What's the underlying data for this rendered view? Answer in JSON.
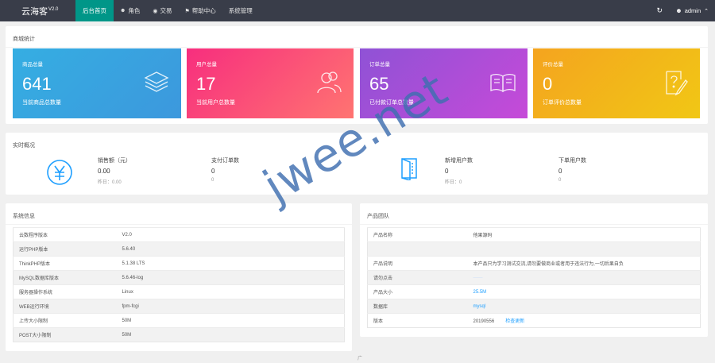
{
  "app": {
    "logo_text": "云海客",
    "logo_version": "V2.0"
  },
  "nav": [
    {
      "label": "后台首页",
      "icon": ""
    },
    {
      "label": "角色",
      "icon": "user-icon"
    },
    {
      "label": "交易",
      "icon": "coins-icon"
    },
    {
      "label": "帮助中心",
      "icon": "flag-icon"
    },
    {
      "label": "系统管理",
      "icon": ""
    }
  ],
  "topright": {
    "refresh_icon": "refresh-icon",
    "user_name": "admin",
    "user_icon": "user-icon",
    "caret_icon": "chevron-up-icon"
  },
  "stats": {
    "title": "商城统计",
    "tiles": [
      {
        "label": "商品总量",
        "value": "641",
        "sub": "当前商品总数量",
        "icon": "layers-icon",
        "color_from": "#34a9e1",
        "color_to": "#3b9bde"
      },
      {
        "label": "用户总量",
        "value": "17",
        "sub": "当前用户总数量",
        "icon": "users-icon",
        "color_from": "#f8317d",
        "color_to": "#ff6f72"
      },
      {
        "label": "订单总量",
        "value": "65",
        "sub": "已付款订单总数量",
        "icon": "book-icon",
        "color_from": "#8e51d6",
        "color_to": "#c24ad8"
      },
      {
        "label": "评价总量",
        "value": "0",
        "sub": "订单评价总数量",
        "icon": "edit-icon",
        "color_from": "#f3a51f",
        "color_to": "#f1c516"
      }
    ]
  },
  "realtime": {
    "title": "实时概况",
    "items": [
      {
        "label": "销售额（元）",
        "value": "0.00",
        "sub": "昨日：0.00"
      },
      {
        "label": "支付订单数",
        "value": "0",
        "sub": "0"
      },
      {
        "label": "新增用户数",
        "value": "0",
        "sub": "昨日：0"
      },
      {
        "label": "下单用户数",
        "value": "0",
        "sub": "0"
      }
    ]
  },
  "system": {
    "title": "系统信息",
    "rows": [
      [
        "云数程序版本",
        "V2.0"
      ],
      [
        "运行PHP版本",
        "5.6.40"
      ],
      [
        "ThinkPHP版本",
        "5.1.38 LTS"
      ],
      [
        "MySQL数据库版本",
        "5.6.46-log"
      ],
      [
        "服务器操作系统",
        "Linux"
      ],
      [
        "WEB运行环境",
        "fpm-fcgi"
      ],
      [
        "上传大小限制",
        "50M"
      ],
      [
        "POST大小限制",
        "50M"
      ]
    ]
  },
  "product": {
    "title": "产品团队",
    "rows": [
      {
        "k": "产品名称",
        "v": "他果源码",
        "link": ""
      },
      {
        "k": "",
        "v": "",
        "link": ""
      },
      {
        "k": "产品说明",
        "v": "本产品只为学习测试交流,请勿要做商业或者用于违法行为,一切后果自负",
        "link": ""
      },
      {
        "k": "请勿点击",
        "v": "——",
        "link": ""
      },
      {
        "k": "产品大小",
        "v": "25.5M",
        "link": ""
      },
      {
        "k": "数据库",
        "v": "mysql",
        "link": ""
      },
      {
        "k": "版本",
        "v": "20190556",
        "link": "检查更新"
      }
    ]
  },
  "watermark": "jwee.net",
  "footer_mark": "广"
}
